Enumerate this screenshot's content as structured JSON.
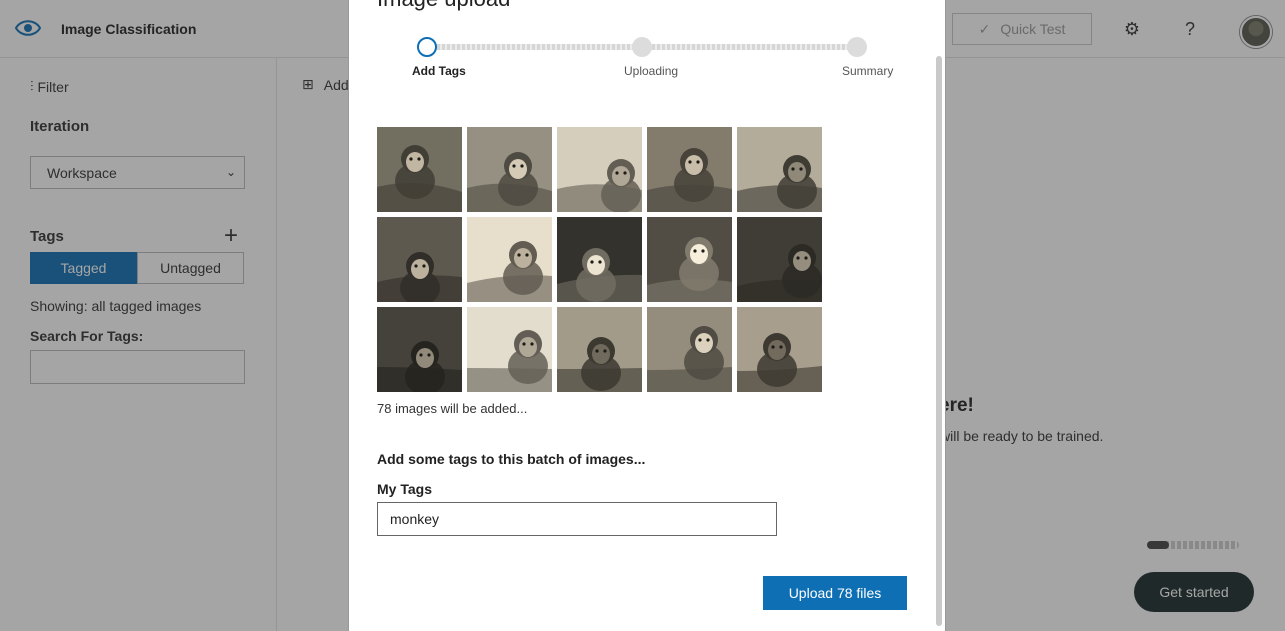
{
  "app": {
    "title": "Image Classification",
    "quick_test_label": "Quick Test",
    "settings_icon": "gear-icon",
    "help_label": "?"
  },
  "sidebar": {
    "filter_label": "Filter",
    "iteration_label": "Iteration",
    "iteration_value": "Workspace",
    "tags_label": "Tags",
    "tagged_label": "Tagged",
    "untagged_label": "Untagged",
    "showing_text": "Showing: all tagged images",
    "search_label": "Search For Tags:",
    "search_value": ""
  },
  "main": {
    "add_images_label": "Add",
    "heading": "ere!",
    "subtext": "will be ready to be trained.",
    "progress_fraction": 0.24,
    "get_started_label": "Get started"
  },
  "modal": {
    "title": "Image upload",
    "steps": [
      {
        "label": "Add Tags",
        "state": "active"
      },
      {
        "label": "Uploading",
        "state": "pending"
      },
      {
        "label": "Summary",
        "state": "pending"
      }
    ],
    "thumbnails": [
      {
        "alt": "monkey on branch"
      },
      {
        "alt": "two young monkeys"
      },
      {
        "alt": "monkeys in snow"
      },
      {
        "alt": "monkey family"
      },
      {
        "alt": "monkey group on rocks"
      },
      {
        "alt": "monkey face close-up"
      },
      {
        "alt": "surprised monkey"
      },
      {
        "alt": "white monkey in trees"
      },
      {
        "alt": "white-faced monkey"
      },
      {
        "alt": "two dark monkeys"
      },
      {
        "alt": "monkey in foliage"
      },
      {
        "alt": "monkey on snowy rocks"
      },
      {
        "alt": "monkey with stick"
      },
      {
        "alt": "pair of monkeys"
      },
      {
        "alt": "mother and baby monkey"
      }
    ],
    "count_note": "78 images will be added...",
    "batch_heading": "Add some tags to this batch of images...",
    "my_tags_label": "My Tags",
    "my_tags_value": "monkey",
    "upload_label": "Upload 78 files"
  }
}
